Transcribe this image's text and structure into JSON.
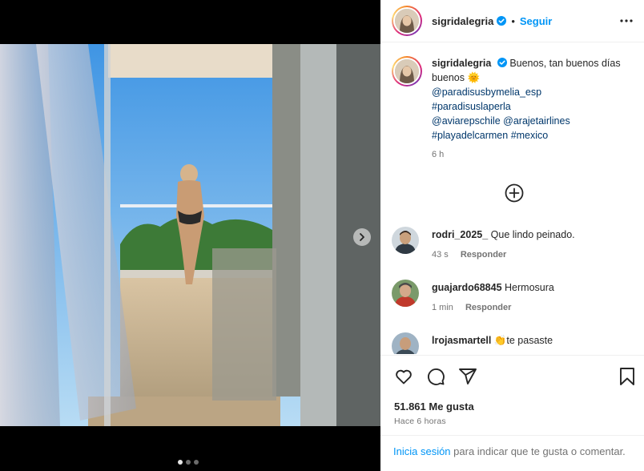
{
  "post": {
    "username": "sigridalegria",
    "follow_label": "Seguir",
    "bullet": "•",
    "caption_text": "Buenos, tan buenos días buenos",
    "caption_emoji": "🌞",
    "mentions": [
      "@paradisusbymelia_esp",
      "#paradisuslaperla",
      "@aviarepschile",
      "@arajetairlines",
      "#playadelcarmen",
      "#mexico"
    ],
    "caption_time": "6 h",
    "likes": "51.861 Me gusta",
    "posted_ago": "Hace 6 horas",
    "carousel": {
      "count": 3,
      "active": 0
    }
  },
  "comments": [
    {
      "user": "rodri_2025_",
      "text": "Que lindo peinado.",
      "time": "43 s",
      "reply_label": "Responder"
    },
    {
      "user": "guajardo68845",
      "text": "Hermosura",
      "time": "1 min",
      "reply_label": "Responder"
    },
    {
      "user": "lrojasmartell",
      "emoji": "👏",
      "text": "te pasaste"
    }
  ],
  "login_bar": {
    "link": "Inicia sesión",
    "text": " para indicar que te gusta o comentar."
  },
  "icons": {
    "verified": "verified-badge-icon",
    "more": "more-options-icon",
    "add": "add-circle-icon",
    "next": "chevron-right-icon",
    "like": "heart-icon",
    "comment": "comment-icon",
    "share": "send-icon",
    "save": "bookmark-icon"
  },
  "colors": {
    "accent": "#0095f6",
    "link": "#00376b",
    "muted": "#737373",
    "verified": "#0095f6"
  }
}
